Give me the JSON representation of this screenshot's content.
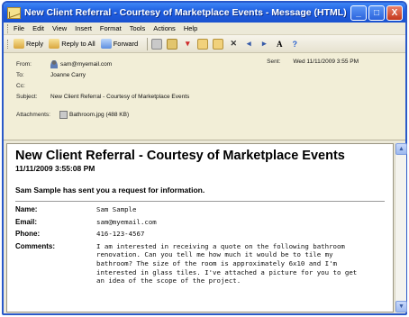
{
  "window": {
    "title": "New Client Referral - Courtesy of Marketplace Events - Message (HTML)",
    "controls": [
      "_",
      "□",
      "X"
    ]
  },
  "menu": [
    "File",
    "Edit",
    "View",
    "Insert",
    "Format",
    "Tools",
    "Actions",
    "Help"
  ],
  "toolbar": {
    "reply": "Reply",
    "reply_all": "Reply to All",
    "forward": "Forward"
  },
  "header": {
    "from_label": "From:",
    "from_value": "sam@myemail.com",
    "to_label": "To:",
    "to_value": "Joanne Carry",
    "cc_label": "Cc:",
    "cc_value": "",
    "subject_label": "Subject:",
    "subject_value": "New Client Referral - Courtesy of Marketplace Events",
    "attachments_label": "Attachments:",
    "attachments_value": "Bathroom.jpg (488 KB)",
    "sent_label": "Sent:",
    "sent_value": "Wed 11/11/2009 3:55 PM"
  },
  "body": {
    "title": "New Client Referral - Courtesy of Marketplace Events",
    "date": "11/11/2009 3:55:08 PM",
    "intro": "Sam Sample has sent you a request for information.",
    "fields": [
      {
        "label": "Name:",
        "value": "Sam Sample"
      },
      {
        "label": "Email:",
        "value": "sam@myemail.com"
      },
      {
        "label": "Phone:",
        "value": "416-123-4567"
      },
      {
        "label": "Comments:",
        "value": "I am interested in receiving a quote on the following bathroom renovation. Can you tell me how much it would be to tile my bathroom? The size of the room is approximately 6x10 and I'm interested in glass tiles. I've attached a picture for you to get an idea of the scope of the project."
      }
    ]
  },
  "colors": {
    "titlebar": "#1f5ee0",
    "chrome": "#ece9d8",
    "header_pane": "#f2eed7"
  }
}
